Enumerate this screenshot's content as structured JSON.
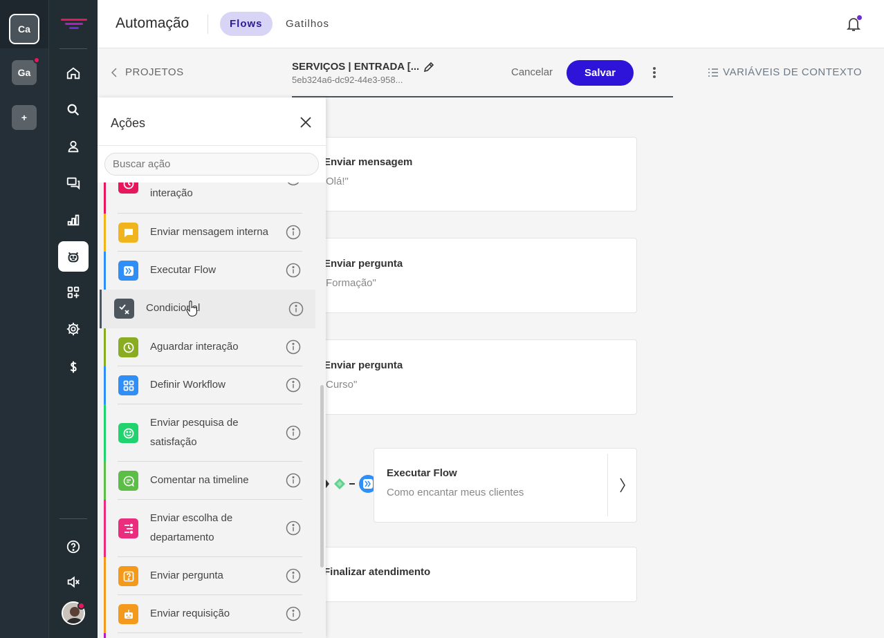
{
  "workspaces": [
    {
      "initials": "Ca",
      "selected": true
    },
    {
      "initials": "Ga",
      "notification": true
    },
    {
      "initials": "+"
    }
  ],
  "nav_icons": [
    "home-icon",
    "search-icon",
    "user-icon",
    "chat-icon",
    "chart-icon",
    "bot-icon",
    "apps-add-icon",
    "gear-icon",
    "dollar-icon",
    "help-icon",
    "sound-muted-icon",
    "avatar"
  ],
  "header": {
    "title": "Automação",
    "tabs": [
      {
        "label": "Flows",
        "active": true
      },
      {
        "label": "Gatilhos",
        "active": false
      }
    ]
  },
  "subheader": {
    "back_label": "PROJETOS",
    "flow_name": "SERVIÇOS | ENTRADA [...",
    "flow_id": "5eb324a6-dc92-44e3-958...",
    "cancel_label": "Cancelar",
    "save_label": "Salvar",
    "context_vars_label": "VARIÁVEIS DE CONTEXTO"
  },
  "canvas": {
    "cards": [
      {
        "title": "Enviar mensagem",
        "subtitle": "Olá!\""
      },
      {
        "title": "Enviar pergunta",
        "subtitle": "Formação\""
      },
      {
        "title": "Enviar pergunta",
        "subtitle": "Curso\""
      },
      {
        "title": "Executar Flow",
        "subtitle": "Como encantar meus clientes"
      },
      {
        "title": "Finalizar atendimento",
        "subtitle": ""
      }
    ]
  },
  "panel": {
    "title": "Ações",
    "search_placeholder": "Buscar ação",
    "items": [
      {
        "label": "interação",
        "icon": "clock-icon",
        "color": "#e8175d"
      },
      {
        "label": "Enviar mensagem interna",
        "icon": "message-icon",
        "color": "#f0b41e"
      },
      {
        "label": "Executar Flow",
        "icon": "chevrons-right-icon",
        "color": "#2f8ff7"
      },
      {
        "label": "Condicional",
        "icon": "conditional-icon",
        "color": "#4d565c"
      },
      {
        "label": "Aguardar interação",
        "icon": "clock-icon",
        "color": "#8aac23"
      },
      {
        "label": "Definir Workflow",
        "icon": "grid-icon",
        "color": "#2f8ff7"
      },
      {
        "label": "Enviar pesquisa de satisfação",
        "icon": "smile-icon",
        "color": "#21d36f"
      },
      {
        "label": "Comentar na timeline",
        "icon": "comment-icon",
        "color": "#5cbd47"
      },
      {
        "label": "Enviar escolha de departamento",
        "icon": "department-icon",
        "color": "#ea2d7c"
      },
      {
        "label": "Enviar pergunta",
        "icon": "question-icon",
        "color": "#f39a1d"
      },
      {
        "label": "Enviar requisição",
        "icon": "robot-icon",
        "color": "#f39a1d"
      }
    ]
  }
}
